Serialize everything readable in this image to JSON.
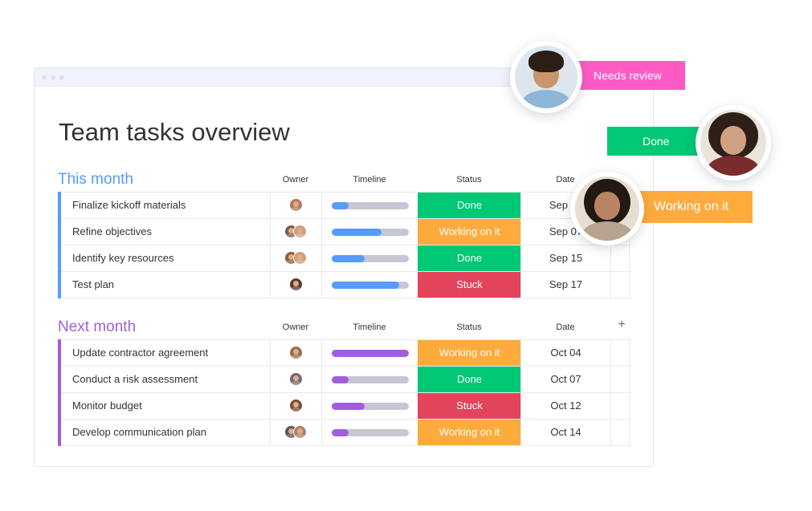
{
  "page": {
    "title": "Team tasks overview"
  },
  "columns": {
    "owner": "Owner",
    "timeline": "Timeline",
    "status": "Status",
    "date": "Date",
    "add": "+"
  },
  "colors": {
    "done": "#00c875",
    "working": "#fdab3d",
    "stuck": "#e2445c",
    "needs_review": "#ff5ac4",
    "this_month": "#579bfc",
    "next_month": "#a25ddc"
  },
  "groups": [
    {
      "title": "This month",
      "color": "#579bfc",
      "rows": [
        {
          "task": "Finalize kickoff materials",
          "owners": [
            "#b07a5a"
          ],
          "timeline": 0.22,
          "status": "Done",
          "status_color": "#00c875",
          "date": "Sep 01"
        },
        {
          "task": "Refine objectives",
          "owners": [
            "#7d5b49",
            "#c9a07f"
          ],
          "timeline": 0.65,
          "status": "Working on it",
          "status_color": "#fdab3d",
          "date": "Sep 07"
        },
        {
          "task": "Identify key resources",
          "owners": [
            "#8c5e43",
            "#d49c78"
          ],
          "timeline": 0.43,
          "status": "Done",
          "status_color": "#00c875",
          "date": "Sep 15"
        },
        {
          "task": "Test plan",
          "owners": [
            "#5a3b2e"
          ],
          "timeline": 0.87,
          "status": "Stuck",
          "status_color": "#e2445c",
          "date": "Sep 17"
        }
      ]
    },
    {
      "title": "Next month",
      "color": "#a25ddc",
      "rows": [
        {
          "task": "Update contractor agreement",
          "owners": [
            "#9c6b52"
          ],
          "timeline": 1.0,
          "status": "Working on it",
          "status_color": "#fdab3d",
          "date": "Oct 04"
        },
        {
          "task": "Conduct a risk assessment",
          "owners": [
            "#6f6a78"
          ],
          "timeline": 0.22,
          "status": "Done",
          "status_color": "#00c875",
          "date": "Oct 07"
        },
        {
          "task": "Monitor budget",
          "owners": [
            "#7a4e3a"
          ],
          "timeline": 0.43,
          "status": "Stuck",
          "status_color": "#e2445c",
          "date": "Oct 12"
        },
        {
          "task": "Develop communication plan",
          "owners": [
            "#5d5552",
            "#a8836b"
          ],
          "timeline": 0.22,
          "status": "Working on it",
          "status_color": "#fdab3d",
          "date": "Oct 14"
        }
      ]
    }
  ],
  "floating": [
    {
      "label": "Needs review",
      "color": "#ff5ac4",
      "avatar": "man-avatar"
    },
    {
      "label": "Done",
      "color": "#00c875",
      "avatar": "woman-curly-avatar"
    },
    {
      "label": "Working on it",
      "color": "#fdab3d",
      "avatar": "woman-smiling-avatar"
    }
  ]
}
